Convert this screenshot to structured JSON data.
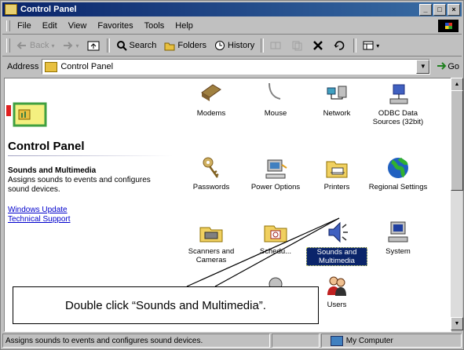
{
  "window": {
    "title": "Control Panel",
    "buttons": [
      "_",
      "□",
      "×"
    ]
  },
  "menu": [
    "File",
    "Edit",
    "View",
    "Favorites",
    "Tools",
    "Help"
  ],
  "toolbar": {
    "back": "Back",
    "search": "Search",
    "folders": "Folders",
    "history": "History"
  },
  "address": {
    "label": "Address",
    "value": "Control Panel",
    "go": "Go"
  },
  "left_pane": {
    "title": "Control Panel",
    "selected_name": "Sounds and Multimedia",
    "selected_desc": "Assigns sounds to events and configures sound devices.",
    "links": [
      "Windows Update",
      "Technical Support"
    ]
  },
  "items": [
    {
      "label": "Modems",
      "icon": "modem-icon"
    },
    {
      "label": "Mouse",
      "icon": "mouse-icon"
    },
    {
      "label": "Network",
      "icon": "network-icon"
    },
    {
      "label": "ODBC Data Sources (32bit)",
      "icon": "odbc-icon"
    },
    {
      "label": "Passwords",
      "icon": "keys-icon"
    },
    {
      "label": "Power Options",
      "icon": "power-icon"
    },
    {
      "label": "Printers",
      "icon": "printer-folder-icon"
    },
    {
      "label": "Regional Settings",
      "icon": "globe-icon"
    },
    {
      "label": "Scanners and Cameras",
      "icon": "scanner-icon"
    },
    {
      "label": "Schedu...",
      "icon": "scheduled-tasks-icon"
    },
    {
      "label": "Sounds and Multimedia",
      "icon": "speaker-icon"
    },
    {
      "label": "System",
      "icon": "computer-icon"
    },
    {
      "label": "Users",
      "icon": "users-icon"
    }
  ],
  "callout": "Double click “Sounds and Multimedia”.",
  "status": {
    "text": "Assigns sounds to events and configures sound devices.",
    "zone": "My Computer"
  },
  "colors": {
    "titlebar": "#0a246a",
    "selection": "#0a246a",
    "link": "#0000cc"
  }
}
